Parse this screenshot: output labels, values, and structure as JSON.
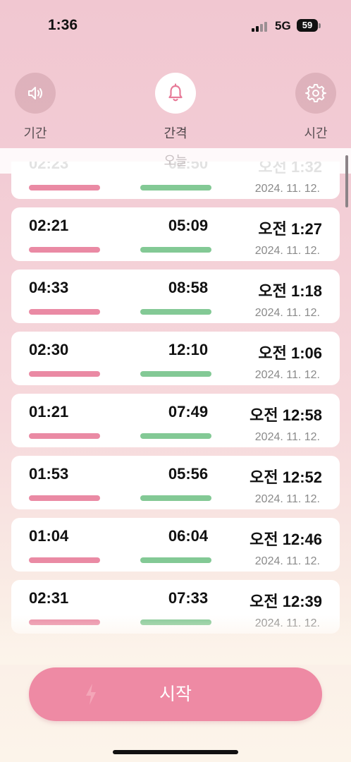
{
  "status_bar": {
    "time": "1:36",
    "network": "5G",
    "battery": "59"
  },
  "top_nav": {
    "items": [
      {
        "label": "기간",
        "icon": "speaker-icon",
        "active": false
      },
      {
        "label": "간격",
        "icon": "bell-icon",
        "active": true
      },
      {
        "label": "시간",
        "icon": "gear-icon",
        "active": false
      }
    ]
  },
  "section_header": "오늘",
  "records": [
    {
      "duration": "02:23",
      "interval": "02:50",
      "time": "오전 1:32",
      "date": "2024. 11. 12."
    },
    {
      "duration": "02:21",
      "interval": "05:09",
      "time": "오전 1:27",
      "date": "2024. 11. 12."
    },
    {
      "duration": "04:33",
      "interval": "08:58",
      "time": "오전 1:18",
      "date": "2024. 11. 12."
    },
    {
      "duration": "02:30",
      "interval": "12:10",
      "time": "오전 1:06",
      "date": "2024. 11. 12."
    },
    {
      "duration": "01:21",
      "interval": "07:49",
      "time": "오전 12:58",
      "date": "2024. 11. 12."
    },
    {
      "duration": "01:53",
      "interval": "05:56",
      "time": "오전 12:52",
      "date": "2024. 11. 12."
    },
    {
      "duration": "01:04",
      "interval": "06:04",
      "time": "오전 12:46",
      "date": "2024. 11. 12."
    },
    {
      "duration": "02:31",
      "interval": "07:33",
      "time": "오전 12:39",
      "date": "2024. 11. 12."
    }
  ],
  "start_button": {
    "label": "시작",
    "icon": "lightning-icon"
  },
  "colors": {
    "accent_pink": "#ee8aa4",
    "duration_bar": "#ea8aa4",
    "interval_bar": "#83c995",
    "bell_icon": "#e77a98"
  }
}
